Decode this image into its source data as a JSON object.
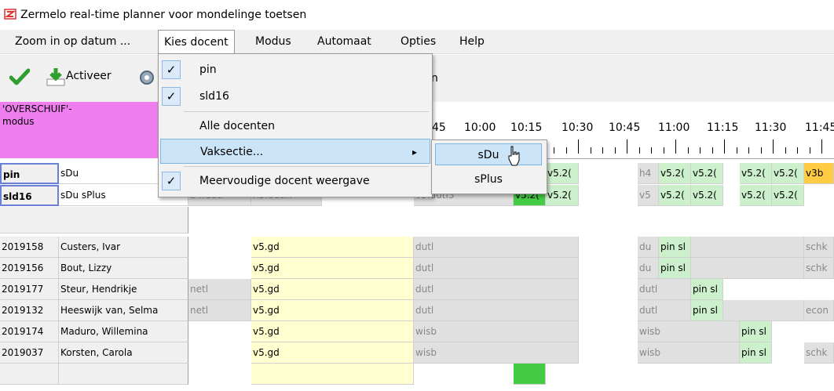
{
  "window": {
    "title": "Zermelo real-time planner voor mondelinge toetsen"
  },
  "menu": [
    {
      "label": "Zoom in op datum ..."
    },
    {
      "label": "Kies docent"
    },
    {
      "label": "Modus"
    },
    {
      "label": "Automaat"
    },
    {
      "label": "Opties"
    },
    {
      "label": "Help"
    }
  ],
  "toolbar": {
    "activate_label": "Activeer",
    "partial_label": "n"
  },
  "mode_header": {
    "line1": "'OVERSCHUIF'-",
    "line2": "modus"
  },
  "timeline": {
    "labels": [
      "45",
      "10:00",
      "10:15",
      "10:30",
      "10:45",
      "11:00",
      "11:15",
      "11:30",
      "11:45"
    ]
  },
  "teachers": [
    {
      "code": "pin",
      "section": "sDu",
      "cells": [
        "v5.2(",
        "h4",
        "v5.2(",
        "v5.2(",
        "v5.2(",
        "v5.2(",
        "v3b"
      ]
    },
    {
      "code": "sld16",
      "section": "sDu sPlus",
      "cells": [
        "b4.dutl",
        "h5.dutlh",
        "v5.dutl3",
        "v5.2(",
        "v5.2(",
        "v5",
        "v5.2(",
        "v5.2(",
        "v5.2(",
        "v5.2("
      ]
    }
  ],
  "students": [
    {
      "id": "2019158",
      "name": "Custers, Ivar",
      "cells": [
        "v5.gd",
        "dutl",
        "du",
        "pin sl",
        "schk"
      ]
    },
    {
      "id": "2019156",
      "name": "Bout, Lizzy",
      "cells": [
        "v5.gd",
        "dutl",
        "du",
        "pin sl",
        "schk"
      ]
    },
    {
      "id": "2019177",
      "name": "Steur, Hendrikje",
      "cells": [
        "netl",
        "v5.gd",
        "dutl",
        "dutl",
        "pin sl"
      ]
    },
    {
      "id": "2019132",
      "name": "Heeswijk van, Selma",
      "cells": [
        "netl",
        "v5.gd",
        "dutl",
        "dutl",
        "pin sl",
        "econ"
      ]
    },
    {
      "id": "2019174",
      "name": "Maduro, Willemina",
      "cells": [
        "v5.gd",
        "wisb",
        "wisb",
        "pin sl"
      ]
    },
    {
      "id": "2019037",
      "name": "Korsten, Carola",
      "cells": [
        "v5.gd",
        "wisb",
        "wisb",
        "pin sl",
        "schk"
      ]
    }
  ],
  "dropdown": {
    "items": [
      {
        "label": "pin",
        "checked": true
      },
      {
        "label": "sld16",
        "checked": true
      },
      {
        "label": "Alle docenten",
        "checked": false
      },
      {
        "label": "Vaksectie...",
        "checked": false,
        "submenu": true
      },
      {
        "label": "Meervoudige docent weergave",
        "checked": true
      }
    ],
    "check_glyph": "✓",
    "arrow_glyph": "▸"
  },
  "submenu": {
    "items": [
      {
        "label": "sDu"
      },
      {
        "label": "sPlus"
      }
    ]
  },
  "icons": [
    "app-icon",
    "checkmark-icon",
    "activate-icon",
    "gear-icon",
    "check-icon",
    "submenu-arrow-icon",
    "mouse-cursor-icon"
  ],
  "colors": {
    "pink": "#ee7eee",
    "yellow": "#ffffd0",
    "green": "#cbf0cb",
    "darkgreen": "#44cc44",
    "orange": "#ffcc44",
    "highlight": "#cce4f7"
  }
}
